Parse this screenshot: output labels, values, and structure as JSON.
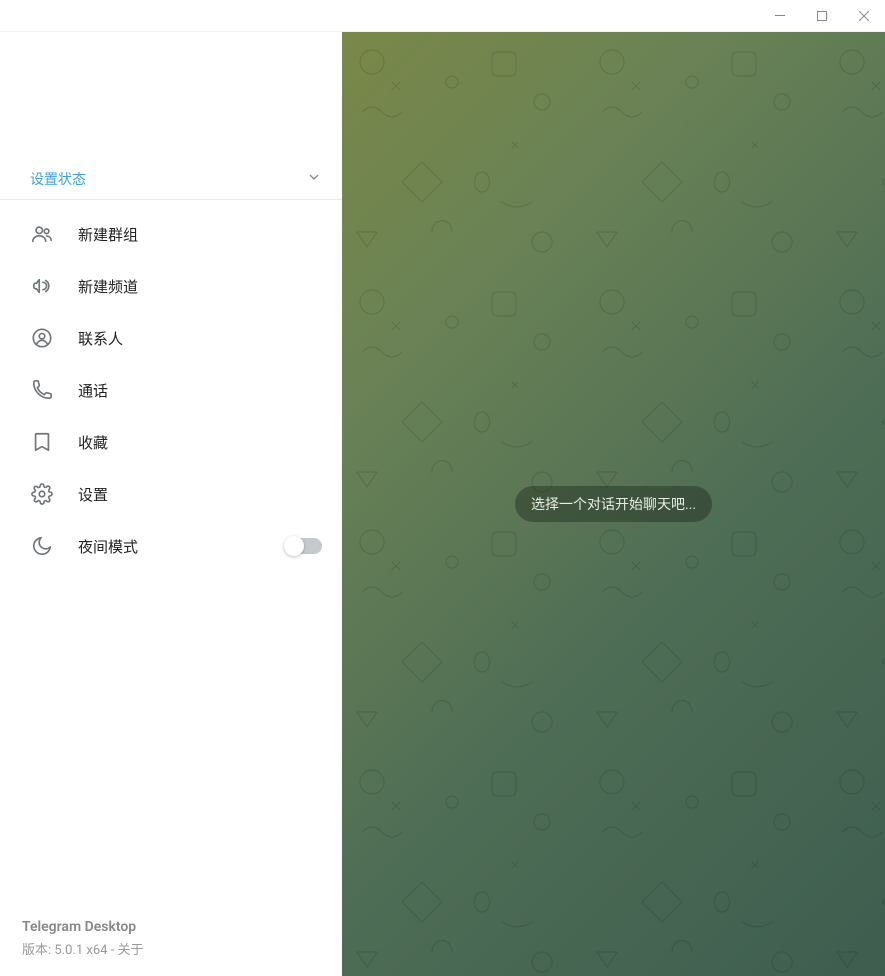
{
  "sidebar": {
    "status_label": "设置状态",
    "menu": [
      {
        "id": "new-group",
        "label": "新建群组"
      },
      {
        "id": "new-channel",
        "label": "新建频道"
      },
      {
        "id": "contacts",
        "label": "联系人"
      },
      {
        "id": "calls",
        "label": "通话"
      },
      {
        "id": "saved",
        "label": "收藏"
      },
      {
        "id": "settings",
        "label": "设置"
      },
      {
        "id": "night-mode",
        "label": "夜间模式"
      }
    ],
    "footer": {
      "title": "Telegram Desktop",
      "version_text": "版本: 5.0.1 x64  - 关于"
    }
  },
  "content": {
    "placeholder_text": "选择一个对话开始聊天吧..."
  }
}
